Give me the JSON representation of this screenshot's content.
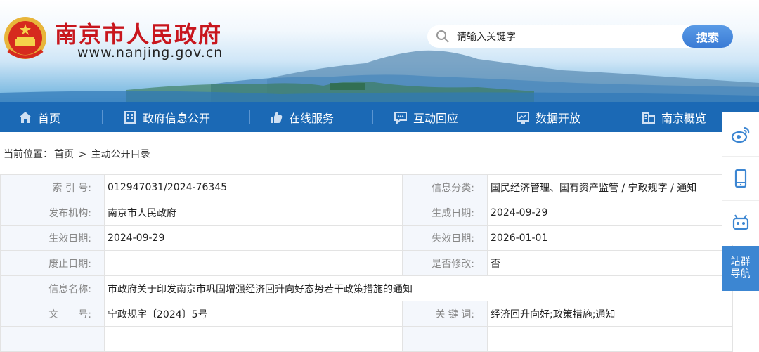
{
  "header": {
    "site_title": "南京市人民政府",
    "site_url": "www.nanjing.gov.cn",
    "search_placeholder": "请输入关键字",
    "search_button": "搜索"
  },
  "nav": {
    "items": [
      {
        "label": "首页",
        "icon": "home-icon"
      },
      {
        "label": "政府信息公开",
        "icon": "building-icon"
      },
      {
        "label": "在线服务",
        "icon": "thumbs-up-icon"
      },
      {
        "label": "互动回应",
        "icon": "chat-icon"
      },
      {
        "label": "数据开放",
        "icon": "chart-icon"
      },
      {
        "label": "南京概览",
        "icon": "city-icon"
      }
    ]
  },
  "breadcrumb": {
    "prefix": "当前位置：",
    "home": "首页",
    "sep": ">",
    "current": "主动公开目录"
  },
  "info": {
    "rows": [
      [
        "索 引 号:",
        "012947031/2024-76345",
        "信息分类:",
        "国民经济管理、国有资产监管 / 宁政规字 / 通知"
      ],
      [
        "发布机构:",
        "南京市人民政府",
        "生成日期:",
        "2024-09-29"
      ],
      [
        "生效日期:",
        "2024-09-29",
        "失效日期:",
        "2026-01-01"
      ],
      [
        "废止日期:",
        "",
        "是否修改:",
        "否"
      ],
      [
        "信息名称:",
        "市政府关于印发南京市巩固增强经济回升向好态势若干政策措施的通知"
      ],
      [
        "文　　号:",
        "宁政规字〔2024〕5号",
        "关 键 词:",
        "经济回升向好;政策措施;通知"
      ]
    ]
  },
  "side": {
    "nav_line1": "站群",
    "nav_line2": "导航"
  },
  "colors": {
    "brand_red": "#c8161d",
    "nav_blue": "#1b69b5",
    "side_blue": "#3c86d2"
  }
}
